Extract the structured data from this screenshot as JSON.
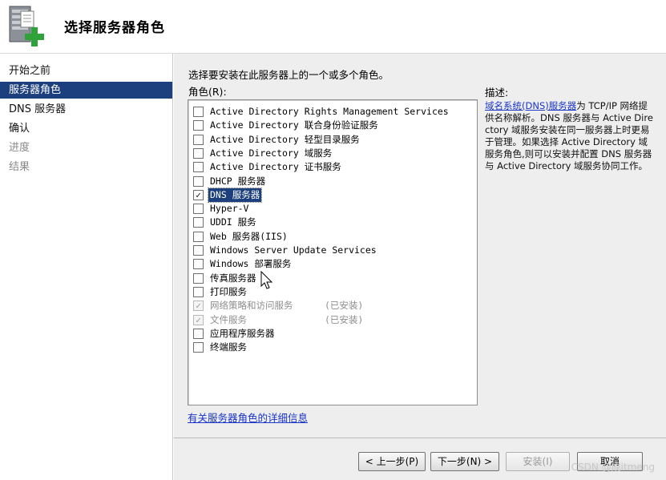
{
  "header": {
    "title": "选择服务器角色",
    "icon": "server-roles-add-icon"
  },
  "nav": {
    "items": [
      {
        "label": "开始之前",
        "state": "normal"
      },
      {
        "label": "服务器角色",
        "state": "selected"
      },
      {
        "label": "DNS 服务器",
        "state": "normal"
      },
      {
        "label": "确认",
        "state": "normal"
      },
      {
        "label": "进度",
        "state": "disabled"
      },
      {
        "label": "结果",
        "state": "disabled"
      }
    ]
  },
  "main": {
    "instruction": "选择要安装在此服务器上的一个或多个角色。",
    "roles_label": "角色(R):",
    "roles": [
      {
        "label": "Active Directory Rights Management Services",
        "checked": false
      },
      {
        "label": "Active Directory 联合身份验证服务",
        "checked": false
      },
      {
        "label": "Active Directory 轻型目录服务",
        "checked": false
      },
      {
        "label": "Active Directory 域服务",
        "checked": false
      },
      {
        "label": "Active Directory 证书服务",
        "checked": false
      },
      {
        "label": "DHCP 服务器",
        "checked": false
      },
      {
        "label": "DNS 服务器",
        "checked": true,
        "highlighted": true
      },
      {
        "label": "Hyper-V",
        "checked": false
      },
      {
        "label": "UDDI 服务",
        "checked": false
      },
      {
        "label": "Web 服务器(IIS)",
        "checked": false
      },
      {
        "label": "Windows Server Update Services",
        "checked": false
      },
      {
        "label": "Windows 部署服务",
        "checked": false
      },
      {
        "label": "传真服务器",
        "checked": false
      },
      {
        "label": "打印服务",
        "checked": false
      },
      {
        "label": "网络策略和访问服务",
        "checked": true,
        "disabled": true,
        "suffix": "(已安装)"
      },
      {
        "label": "文件服务",
        "checked": true,
        "disabled": true,
        "suffix": "(已安装)"
      },
      {
        "label": "应用程序服务器",
        "checked": false
      },
      {
        "label": "终端服务",
        "checked": false
      }
    ],
    "description": {
      "label": "描述:",
      "link": "域名系统(DNS)服务器",
      "text": "为 TCP/IP 网络提供名称解析。DNS 服务器与 Active Directory 域服务安装在同一服务器上时更易于管理。如果选择 Active Directory 域服务角色,则可以安装并配置 DNS 服务器与 Active Directory 域服务协同工作。"
    },
    "more_info_link": "有关服务器角色的详细信息"
  },
  "footer": {
    "prev": "< 上一步(P)",
    "next": "下一步(N) >",
    "install": "安装(I)",
    "cancel": "取消"
  },
  "watermark": "CSDN @成itmeng",
  "colors": {
    "selection": "#1c3f7d",
    "link": "#1a35c7",
    "panel": "#eeeeee"
  }
}
